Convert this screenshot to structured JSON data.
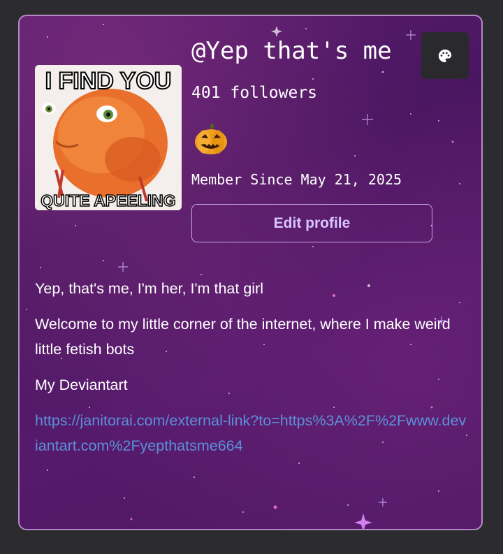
{
  "profile": {
    "handle": "@Yep that's me",
    "followers": "401 followers",
    "member_since": "Member Since May 21, 2025",
    "edit_label": "Edit profile",
    "badge_icon": "jack-o-lantern-icon",
    "avatar": {
      "top_text": "I FIND YOU",
      "bottom_text": "QUITE APEELING"
    }
  },
  "theme_button": {
    "icon": "palette-icon"
  },
  "bio": {
    "lines": [
      "Yep, that's me, I'm her, I'm that girl",
      "Welcome to my little corner of the internet, where I make weird little fetish bots",
      "My Deviantart"
    ],
    "link": "https://janitorai.com/external-link?to=https%3A%2F%2Fwww.deviantart.com%2Fyepthatsme664"
  },
  "colors": {
    "page_bg": "#2b2b30",
    "card_bg": "#4e1865",
    "card_border": "#b58ac4",
    "link": "#5b90d8",
    "button_text": "#d9c6ff"
  }
}
